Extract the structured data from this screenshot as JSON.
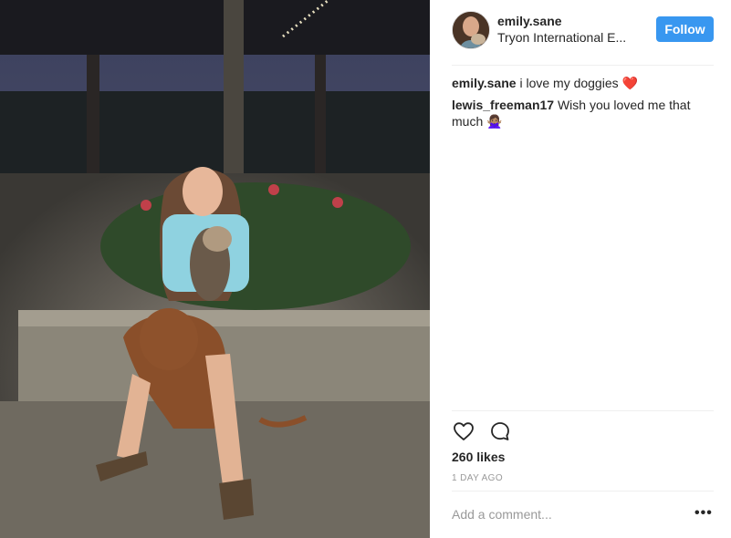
{
  "post": {
    "photo_alt": "Photo by emily.sane"
  },
  "header": {
    "username": "emily.sane",
    "location": "Tryon International E...",
    "follow_label": "Follow"
  },
  "comments": [
    {
      "user": "emily.sane",
      "text": "i love my doggies ❤️"
    },
    {
      "user": "lewis_freeman17",
      "text": "Wish you loved me that much 🙅🏽‍♀️"
    }
  ],
  "actions": {
    "like_icon": "heart-icon",
    "comment_icon": "comment-icon"
  },
  "likes": "260 likes",
  "timestamp": "1 DAY AGO",
  "add_comment": {
    "placeholder": "Add a comment..."
  },
  "more_label": "•••",
  "colors": {
    "follow_button": "#3897f0",
    "heart_emoji": "#e0245e",
    "muted_text": "#999999"
  }
}
